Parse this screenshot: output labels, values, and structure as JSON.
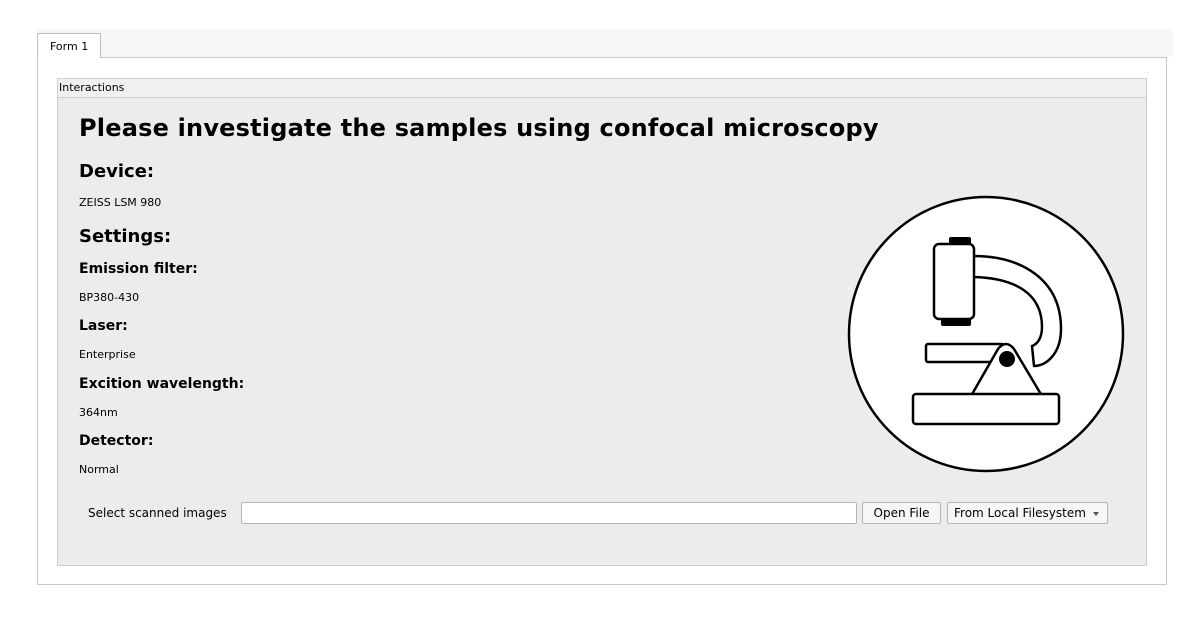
{
  "tabs": [
    {
      "label": "Form 1",
      "active": true
    }
  ],
  "group": {
    "title": "Interactions"
  },
  "content": {
    "title": "Please investigate the samples using confocal microscopy",
    "device_heading": "Device:",
    "device_value": "ZEISS LSM 980",
    "settings_heading": "Settings:",
    "emission_filter_label": "Emission filter:",
    "emission_filter_value": "BP380-430",
    "laser_label": "Laser:",
    "laser_value": "Enterprise",
    "excitation_label": "Excition wavelength:",
    "excitation_value": "364nm",
    "detector_label": "Detector:",
    "detector_value": "Normal"
  },
  "image": {
    "icon": "microscope-icon"
  },
  "file_picker": {
    "label": "Select scanned images",
    "value": "",
    "open_button": "Open File",
    "source_selected": "From Local Filesystem"
  }
}
